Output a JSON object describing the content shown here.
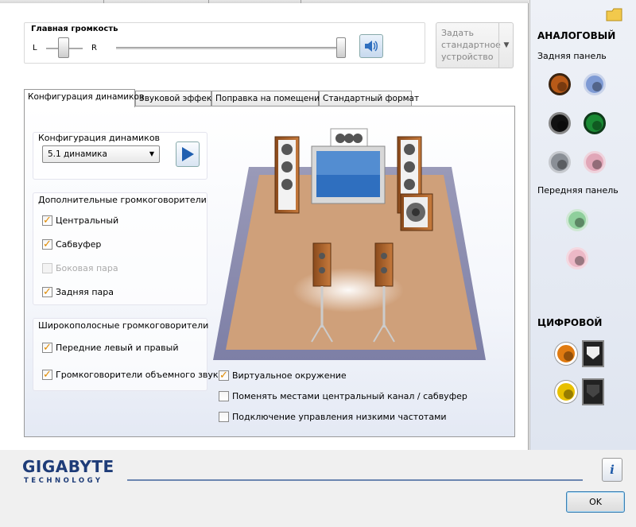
{
  "volume": {
    "title": "Главная громкость",
    "left_label": "L",
    "right_label": "R",
    "balance": 0.5,
    "level": 0.97
  },
  "default_device_button": {
    "label": "Задать стандартное устройство"
  },
  "tabs": [
    {
      "label": "Конфигурация динамиков",
      "active": true
    },
    {
      "label": "Звуковой эффект"
    },
    {
      "label": "Поправка на помещение"
    },
    {
      "label": "Стандартный формат"
    }
  ],
  "speaker_config": {
    "title": "Конфигурация динамиков",
    "selected": "5.1 динамика"
  },
  "optional_speakers": {
    "title": "Дополнительные громкоговорители",
    "items": [
      {
        "label": "Центральный",
        "checked": true,
        "enabled": true
      },
      {
        "label": "Сабвуфер",
        "checked": true,
        "enabled": true
      },
      {
        "label": "Боковая пара",
        "checked": false,
        "enabled": false
      },
      {
        "label": "Задняя пара",
        "checked": true,
        "enabled": true
      }
    ]
  },
  "fullrange_speakers": {
    "title": "Широкополосные громкоговорители",
    "items": [
      {
        "label": "Передние левый и правый",
        "checked": true
      },
      {
        "label": "Громкоговорители объемного звука",
        "checked": true
      }
    ]
  },
  "options": [
    {
      "label": "Виртуальное окружение",
      "checked": true
    },
    {
      "label": "Поменять местами центральный канал / сабвуфер",
      "checked": false
    },
    {
      "label": "Подключение управления низкими частотами",
      "checked": false
    }
  ],
  "right_panel": {
    "analog_title": "АНАЛОГОВЫЙ",
    "rear_panel_label": "Задняя панель",
    "front_panel_label": "Передняя панель",
    "digital_title": "ЦИФРОВОЙ",
    "rear_jacks": [
      {
        "color": "#b85a18",
        "active": true
      },
      {
        "color": "#7e9ad4",
        "active": false
      },
      {
        "color": "#111111",
        "active": true
      },
      {
        "color": "#1a8a34",
        "active": true
      },
      {
        "color": "#8a8f96",
        "active": false
      },
      {
        "color": "#e1a7b8",
        "active": false
      }
    ],
    "front_jacks": [
      {
        "color": "#8fcf9c"
      },
      {
        "color": "#ecb8c6"
      }
    ],
    "digital_jacks": [
      {
        "color": "#e07a10"
      },
      {
        "color": "#e8c000"
      }
    ]
  },
  "brand": {
    "line1": "GIGABYTE",
    "line2": "TECHNOLOGY"
  },
  "ok_button": "OK",
  "icons": {
    "mute": "speaker-icon",
    "play": "play-icon",
    "info": "info-icon",
    "folder": "folder-icon"
  }
}
